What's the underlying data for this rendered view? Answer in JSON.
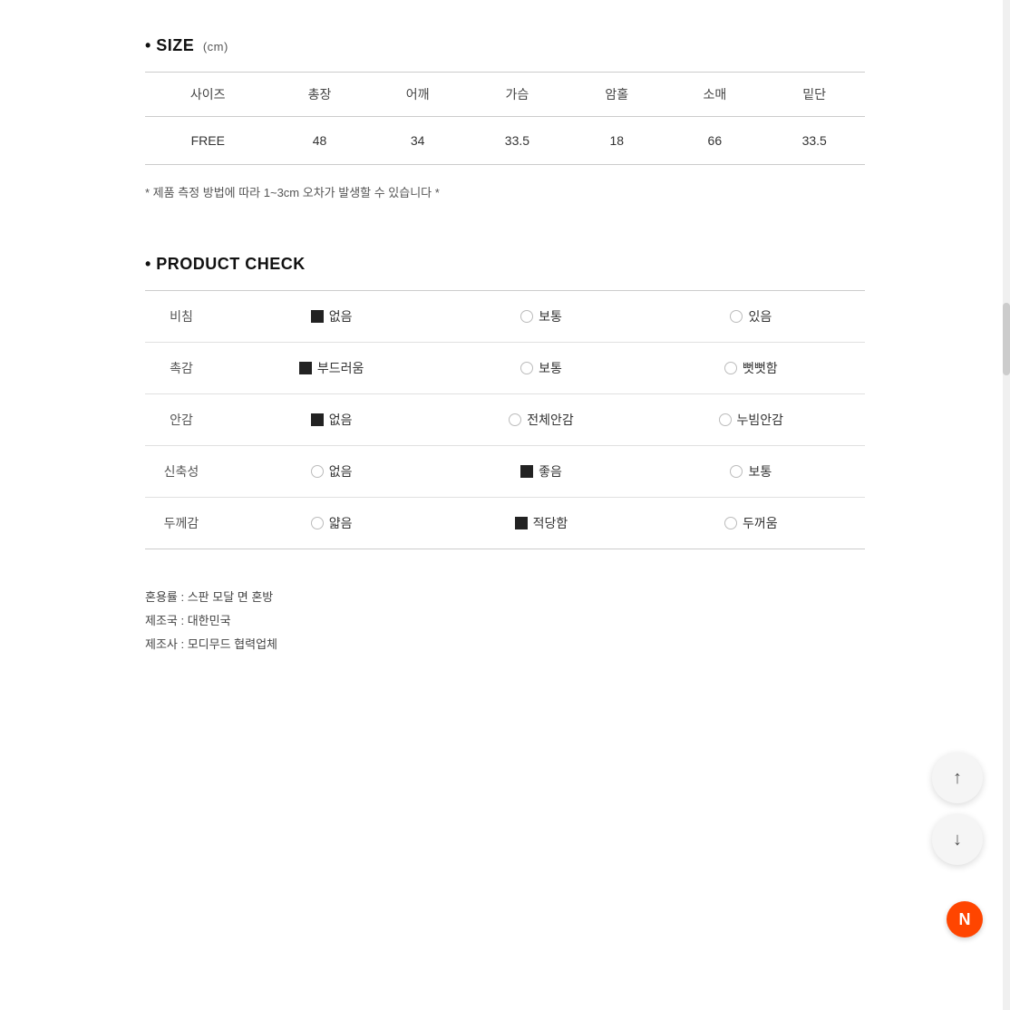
{
  "size_section": {
    "title": "• SIZE",
    "unit": "(cm)",
    "columns": [
      "사이즈",
      "총장",
      "어깨",
      "가슴",
      "암홀",
      "소매",
      "밑단"
    ],
    "rows": [
      [
        "FREE",
        "48",
        "34",
        "33.5",
        "18",
        "66",
        "33.5"
      ]
    ],
    "note": "* 제품 측정 방법에 따라 1~3cm 오차가 발생할 수 있습니다 *"
  },
  "product_check_section": {
    "title": "• PRODUCT CHECK",
    "rows": [
      {
        "label": "비침",
        "options": [
          {
            "type": "filled",
            "text": "없음",
            "selected": true
          },
          {
            "type": "empty",
            "text": "보통",
            "selected": false
          },
          {
            "type": "none",
            "text": "있음",
            "selected": false
          }
        ]
      },
      {
        "label": "촉감",
        "options": [
          {
            "type": "filled",
            "text": "부드러움",
            "selected": true
          },
          {
            "type": "empty",
            "text": "보통",
            "selected": false
          },
          {
            "type": "none",
            "text": "뻣뻣함",
            "selected": false
          }
        ]
      },
      {
        "label": "안감",
        "options": [
          {
            "type": "filled",
            "text": "없음",
            "selected": true
          },
          {
            "type": "empty",
            "text": "전체안감",
            "selected": false
          },
          {
            "type": "none",
            "text": "누빔안감",
            "selected": false
          }
        ]
      },
      {
        "label": "신축성",
        "options": [
          {
            "type": "none",
            "text": "없음",
            "selected": false
          },
          {
            "type": "filled",
            "text": "좋음",
            "selected": true
          },
          {
            "type": "none",
            "text": "보통",
            "selected": false
          }
        ]
      },
      {
        "label": "두께감",
        "options": [
          {
            "type": "none",
            "text": "얇음",
            "selected": false
          },
          {
            "type": "filled",
            "text": "적당함",
            "selected": true
          },
          {
            "type": "none",
            "text": "두꺼움",
            "selected": false
          }
        ]
      }
    ]
  },
  "material_info": {
    "lines": [
      "혼용률 : 스판 모달 면 혼방",
      "제조국 : 대한민국",
      "제조사 : 모디무드 협력업체"
    ]
  },
  "float": {
    "up_label": "↑",
    "down_label": "↓",
    "n_label": "N"
  }
}
